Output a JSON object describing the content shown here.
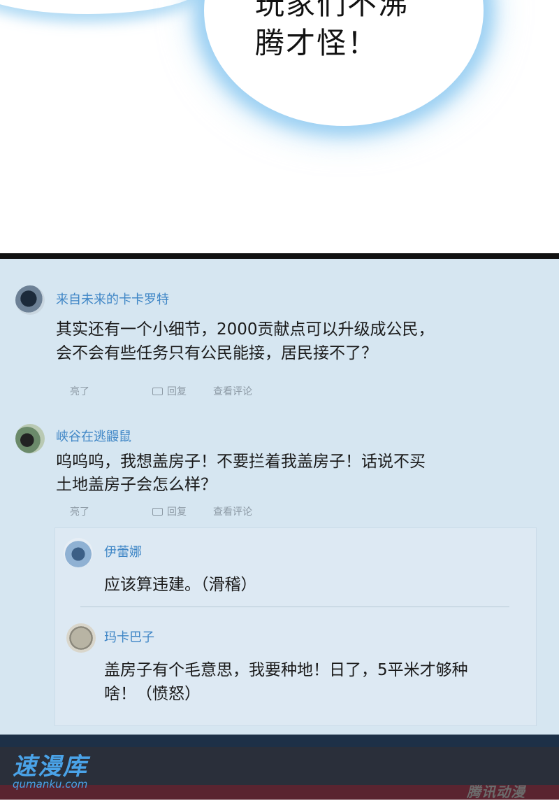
{
  "manga_panel": {
    "bubble_text": "玩家们不沸\n腾才怪！"
  },
  "comments": [
    {
      "username": "来自未来的卡卡罗特",
      "lines": [
        "其实还有一个小细节，2000贡献点可以升级成公民，",
        "会不会有些任务只有公民能接，居民接不了？"
      ],
      "actions": {
        "like": "亮了",
        "reply": "回复",
        "view": "查看评论"
      }
    },
    {
      "username": "峡谷在逃鼹鼠",
      "lines": [
        "呜呜呜，我想盖房子！不要拦着我盖房子！话说不买",
        "土地盖房子会怎么样？"
      ],
      "actions": {
        "like": "亮了",
        "reply": "回复",
        "view": "查看评论"
      },
      "replies": [
        {
          "username": "伊蕾娜",
          "lines": [
            "应该算违建。（滑稽）"
          ]
        },
        {
          "username": "玛卡巴子",
          "lines": [
            "盖房子有个毛意思，我要种地！日了，5平米才够种",
            "啥！（愤怒）"
          ]
        }
      ]
    }
  ],
  "watermark": {
    "site_name": "速漫库",
    "site_url": "qumanku.com",
    "publisher": "腾讯动漫"
  },
  "colors": {
    "username": "#3f86c6",
    "panel_bg": "#d6e6f1",
    "watermark": "#4aa3e8"
  }
}
